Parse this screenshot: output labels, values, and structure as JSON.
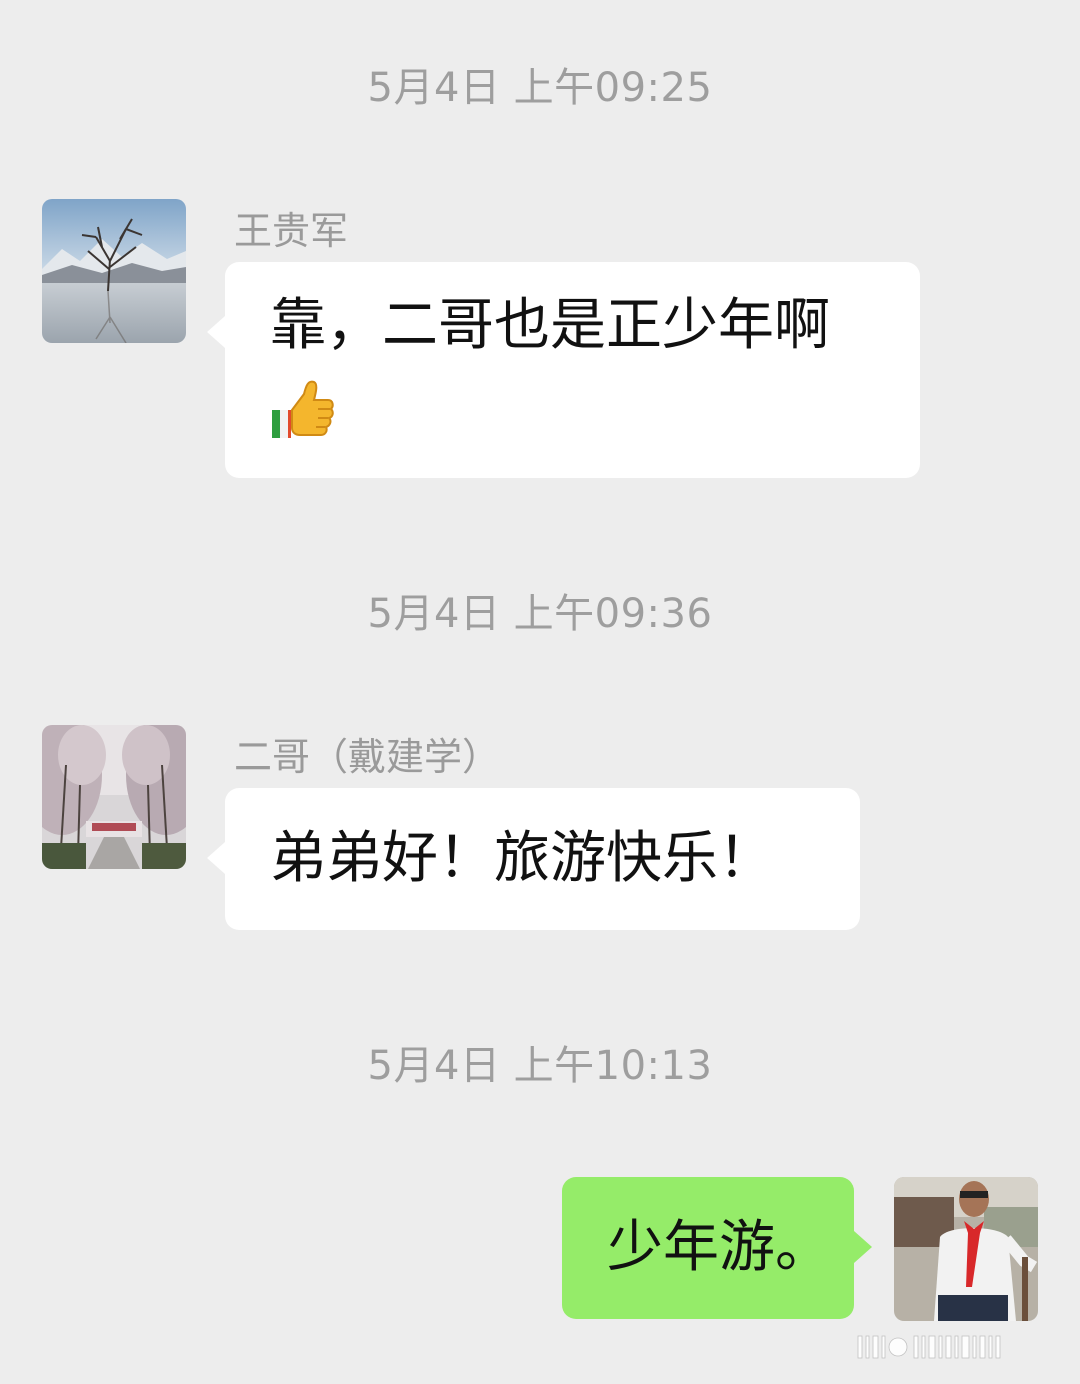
{
  "messages": [
    {
      "timestamp": "5月4日 上午09:25",
      "sender": "王贵军",
      "text": "靠，二哥也是正少年啊",
      "emoji": "thumbs-up"
    },
    {
      "timestamp": "5月4日 上午09:36",
      "sender": "二哥（戴建学）",
      "text": "弟弟好！旅游快乐！"
    },
    {
      "timestamp": "5月4日 上午10:13",
      "text": "少年游。"
    }
  ],
  "colors": {
    "background": "#ededed",
    "incoming_bubble": "#ffffff",
    "outgoing_bubble": "#95ec69",
    "timestamp_text": "#9e9e9e",
    "name_text": "#9a9a9a"
  },
  "icons": {
    "avatar_1": "lone-tree-in-lake-avatar",
    "avatar_2": "blossom-avenue-avatar",
    "avatar_self": "man-with-red-scarf-avatar",
    "emoji": "thumbs-up-icon"
  }
}
